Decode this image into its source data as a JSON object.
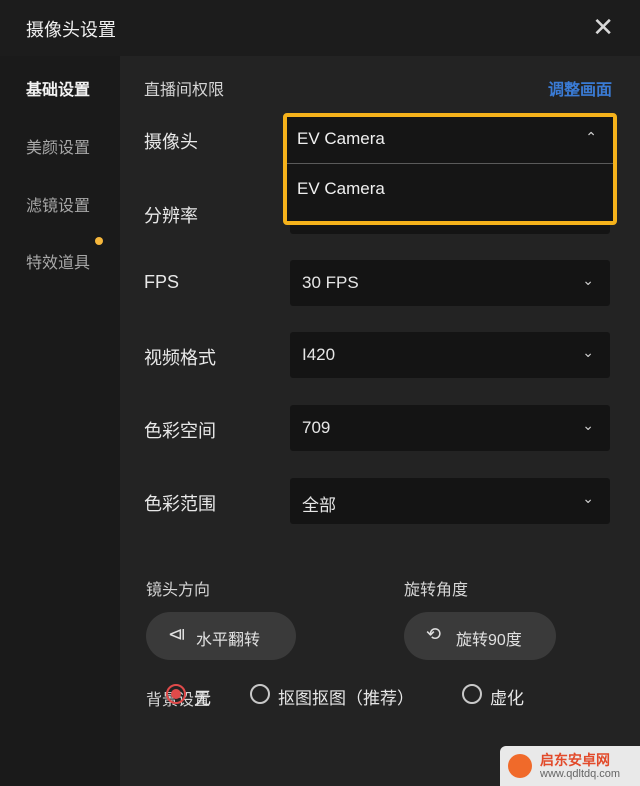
{
  "window": {
    "title": "摄像头设置",
    "close_icon": "close-icon"
  },
  "sidebar": {
    "items": [
      {
        "label": "基础设置",
        "active": true
      },
      {
        "label": "美颜设置",
        "active": false
      },
      {
        "label": "滤镜设置",
        "active": false
      },
      {
        "label": "特效道具",
        "active": false,
        "badge": true
      }
    ]
  },
  "main": {
    "section_title": "直播间权限",
    "link_label": "调整画面",
    "camera": {
      "label": "摄像头",
      "value": "EV Camera",
      "options": [
        "EV Camera"
      ]
    },
    "resolution": {
      "label": "分辨率"
    },
    "fps": {
      "label": "FPS",
      "value": "30 FPS"
    },
    "video_format": {
      "label": "视频格式",
      "value": "I420"
    },
    "color_space": {
      "label": "色彩空间",
      "value": "709"
    },
    "color_range": {
      "label": "色彩范围",
      "value": "全部"
    },
    "lens_direction": {
      "title": "镜头方向",
      "button_label": "水平翻转"
    },
    "rotation": {
      "title": "旋转角度",
      "button_label": "旋转90度"
    },
    "background": {
      "title": "背景设置",
      "options": [
        {
          "label": "无",
          "selected": true
        },
        {
          "label": "抠图抠图（推荐）",
          "selected": false
        },
        {
          "label": "虚化",
          "selected": false
        }
      ]
    }
  },
  "watermark": {
    "line1": "启东安卓网",
    "line2": "www.qdltdq.com"
  },
  "colors": {
    "accent": "#f5b21b",
    "link": "#3a7bd5",
    "radio": "#e04a4a"
  }
}
